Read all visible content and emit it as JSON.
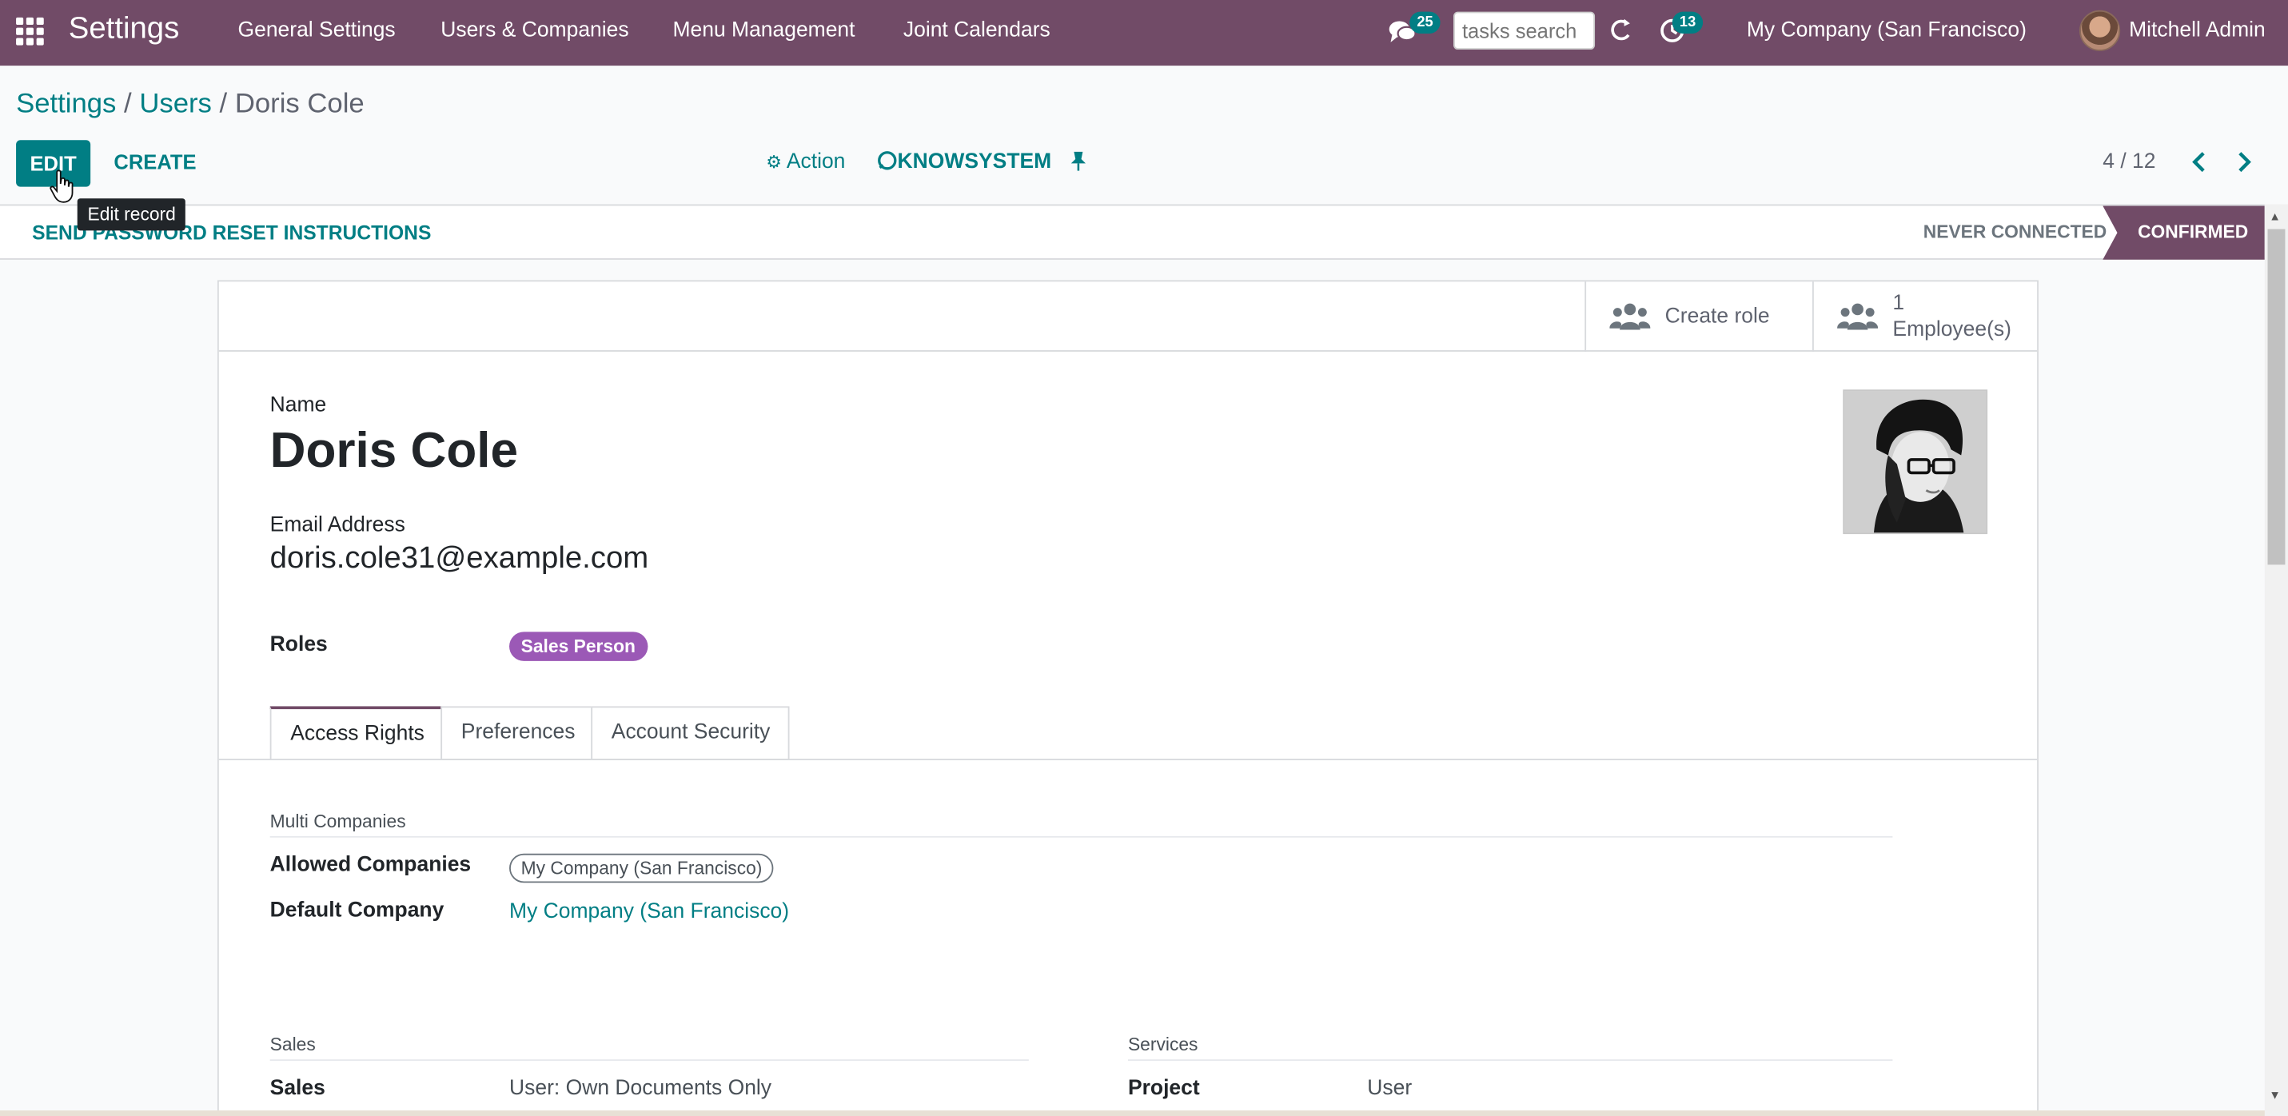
{
  "navbar": {
    "app_title": "Settings",
    "menu": [
      "General Settings",
      "Users & Companies",
      "Menu Management",
      "Joint Calendars"
    ],
    "messages_count": "25",
    "search_placeholder": "tasks search",
    "activities_count": "13",
    "company": "My Company (San Francisco)",
    "user_name": "Mitchell Admin",
    "bar_color": "#714b67"
  },
  "breadcrumb": {
    "root": "Settings",
    "sep1": " / ",
    "parent": "Users",
    "sep2": " / ",
    "current": "Doris Cole"
  },
  "toolbar": {
    "edit_label": "EDIT",
    "create_label": "CREATE",
    "tooltip": "Edit record",
    "action_label": "Action",
    "knowsystem_label": "KNOWSYSTEM",
    "pager": "4 / 12"
  },
  "statusbar": {
    "reset_label": "SEND PASSWORD RESET INSTRUCTIONS",
    "stage_never": "NEVER CONNECTED",
    "stage_confirmed": "CONFIRMED"
  },
  "smart_buttons": {
    "create_role": "Create role",
    "employee_count": "1",
    "employee_label": "Employee(s)"
  },
  "form": {
    "name_label": "Name",
    "name_value": "Doris Cole",
    "email_label": "Email Address",
    "email_value": "doris.cole31@example.com",
    "roles_label": "Roles",
    "role_tag": "Sales Person",
    "role_tag_color": "#9b59b6"
  },
  "tabs": [
    "Access Rights",
    "Preferences",
    "Account Security"
  ],
  "access_rights": {
    "multi_companies_title": "Multi Companies",
    "allowed_companies_label": "Allowed Companies",
    "allowed_companies_tag": "My Company (San Francisco)",
    "default_company_label": "Default Company",
    "default_company_value": "My Company (San Francisco)",
    "sales_title": "Sales",
    "sales_label": "Sales",
    "sales_value": "User: Own Documents Only",
    "services_title": "Services",
    "project_label": "Project",
    "project_value": "User"
  },
  "accent_color": "#017e84"
}
